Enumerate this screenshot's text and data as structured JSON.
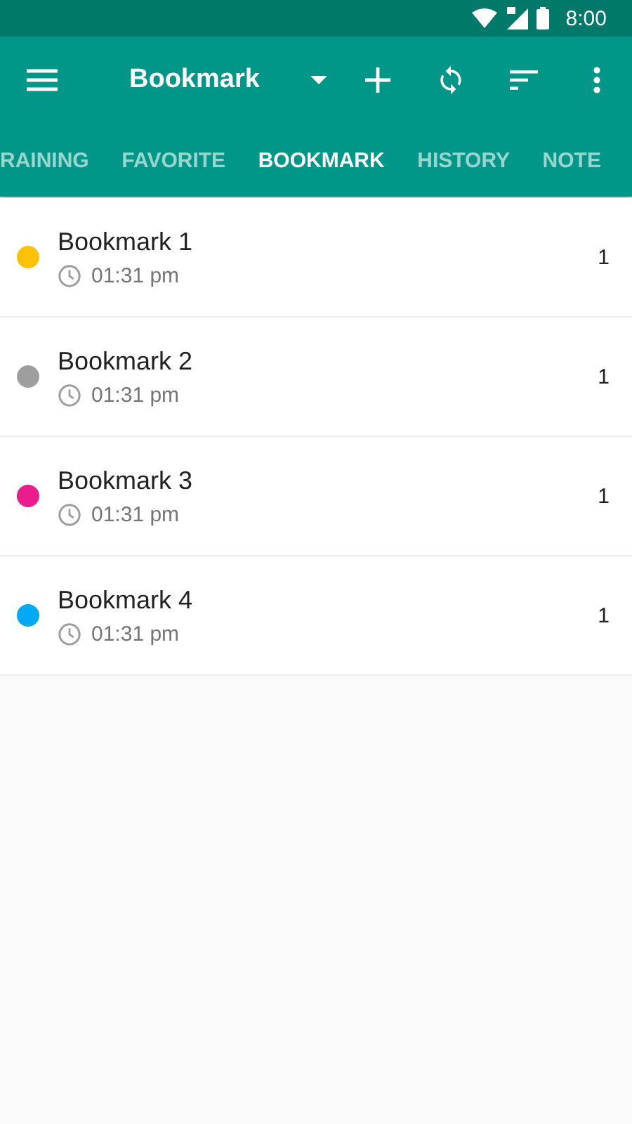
{
  "status_bar": {
    "time": "8:00"
  },
  "toolbar": {
    "title": "Bookmark"
  },
  "tabs": [
    {
      "label": "RAINING",
      "selected": false
    },
    {
      "label": "FAVORITE",
      "selected": false
    },
    {
      "label": "BOOKMARK",
      "selected": true
    },
    {
      "label": "HISTORY",
      "selected": false
    },
    {
      "label": "NOTE",
      "selected": false
    }
  ],
  "bookmarks": [
    {
      "name": "Bookmark 1",
      "time": "01:31 pm",
      "count": "1",
      "color": "#ffc107"
    },
    {
      "name": "Bookmark 2",
      "time": "01:31 pm",
      "count": "1",
      "color": "#9e9e9e"
    },
    {
      "name": "Bookmark 3",
      "time": "01:31 pm",
      "count": "1",
      "color": "#e91e8c"
    },
    {
      "name": "Bookmark 4",
      "time": "01:31 pm",
      "count": "1",
      "color": "#03a9f4"
    }
  ]
}
